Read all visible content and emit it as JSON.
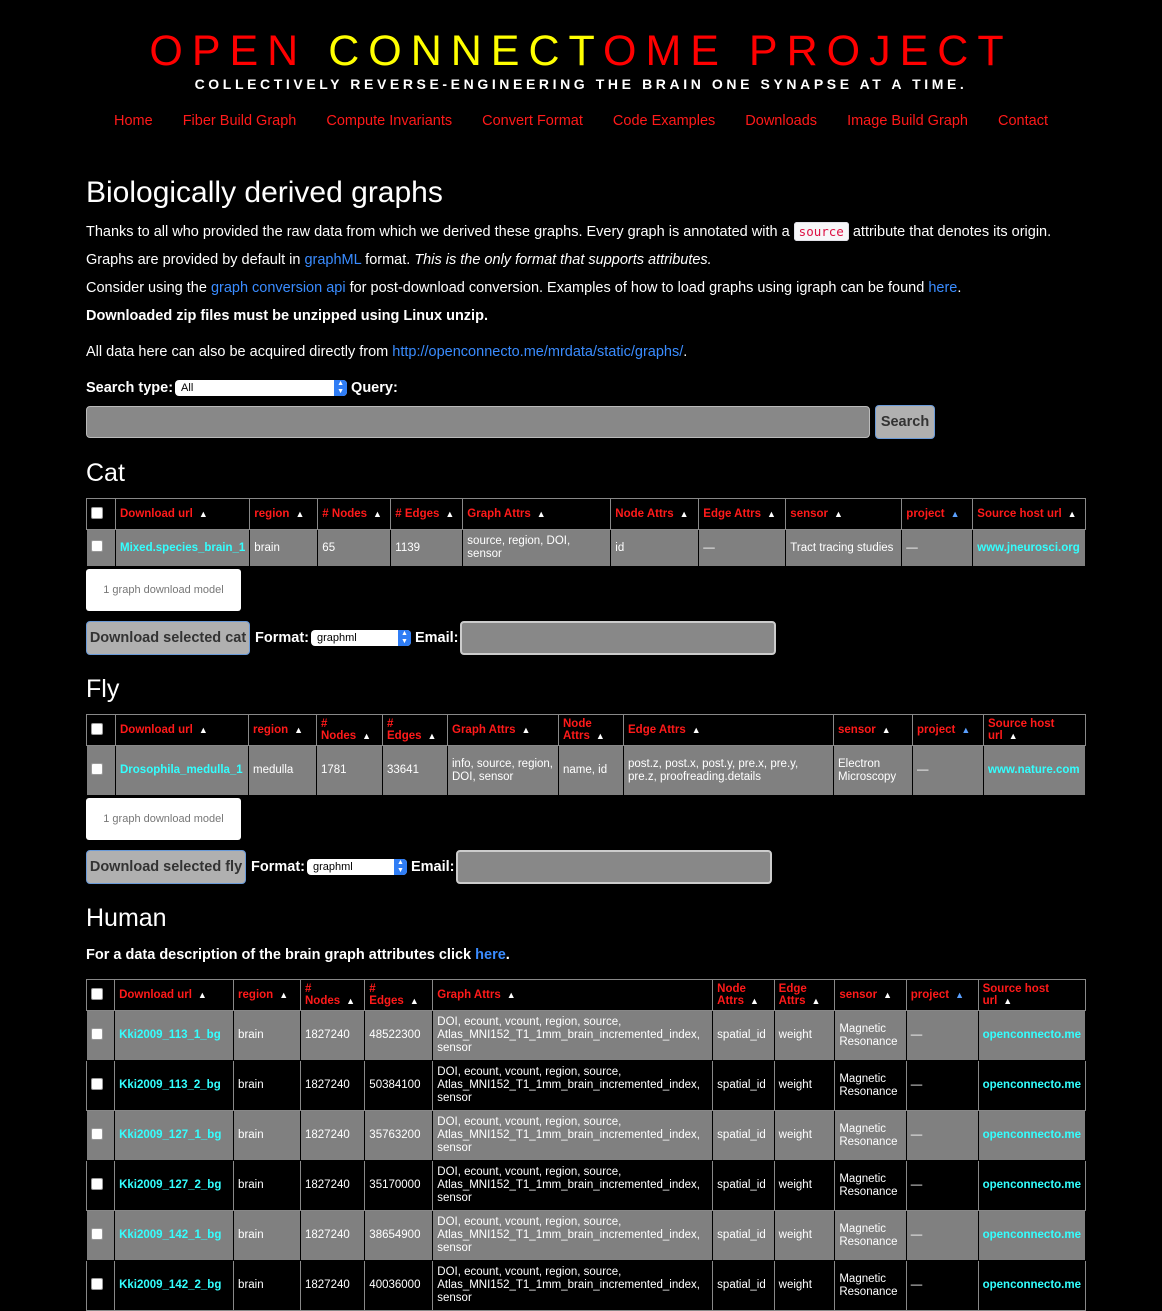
{
  "header": {
    "title_part1": "OPEN ",
    "title_part2": "CONNECT",
    "title_part3": "OME PROJECT",
    "tagline": "COLLECTIVELY REVERSE-ENGINEERING THE BRAIN ONE SYNAPSE AT A TIME."
  },
  "nav": [
    "Home",
    "Fiber Build Graph",
    "Compute Invariants",
    "Convert Format",
    "Code Examples",
    "Downloads",
    "Image Build Graph",
    "Contact"
  ],
  "page": {
    "title": "Biologically derived graphs",
    "p1_before": "Thanks to all who provided the raw data from which we derived these graphs. Every graph is annotated with a ",
    "p1_code": "source",
    "p1_after": " attribute that denotes its origin.",
    "p2_before": "Graphs are provided by default in ",
    "p2_link": "graphML",
    "p2_mid": " format. ",
    "p2_italic": "This is the only format that supports attributes.",
    "p3_before": "Consider using the ",
    "p3_link1": "graph conversion api",
    "p3_mid": " for post-download conversion. Examples of how to load graphs using igraph can be found ",
    "p3_link2": "here",
    "p3_after": ".",
    "p4": "Downloaded zip files must be unzipped using Linux unzip.",
    "p5_before": "All data here can also be acquired directly from ",
    "p5_link": "http://openconnecto.me/mrdata/static/graphs/",
    "p5_after": "."
  },
  "search": {
    "type_label": "Search type:",
    "type_value": "All",
    "query_label": "Query:",
    "button": "Search"
  },
  "cat": {
    "heading": "Cat",
    "headers": [
      "Download url",
      "region",
      "# Nodes",
      "# Edges",
      "Graph Attrs",
      "Node Attrs",
      "Edge Attrs",
      "sensor",
      "project",
      "Source host url"
    ],
    "rows": [
      [
        "Mixed.species_brain_1",
        "brain",
        "65",
        "1139",
        "source, region, DOI, sensor",
        "id",
        "—",
        "Tract tracing studies",
        "—",
        "www.jneurosci.org"
      ]
    ],
    "model_text": "1 graph download model",
    "download_button": "Download selected cat",
    "format_label": "Format:",
    "format_value": "graphml",
    "email_label": "Email:"
  },
  "fly": {
    "heading": "Fly",
    "headers": [
      "Download url",
      "region",
      "# Nodes",
      "# Edges",
      "Graph Attrs",
      "Node Attrs",
      "Edge Attrs",
      "sensor",
      "project",
      "Source host url"
    ],
    "rows": [
      [
        "Drosophila_medulla_1",
        "medulla",
        "1781",
        "33641",
        "info, source, region, DOI, sensor",
        "name, id",
        "post.z, post.x, post.y, pre.x, pre.y, pre.z, proofreading.details",
        "Electron Microscopy",
        "—",
        "www.nature.com"
      ]
    ],
    "model_text": "1 graph download model",
    "download_button": "Download selected fly",
    "format_label": "Format:",
    "format_value": "graphml",
    "email_label": "Email:"
  },
  "human": {
    "heading": "Human",
    "desc_before": "For a data description of the brain graph attributes click ",
    "desc_link": "here",
    "desc_after": ".",
    "headers": [
      "Download url",
      "region",
      "# Nodes",
      "# Edges",
      "Graph Attrs",
      "Node Attrs",
      "Edge Attrs",
      "sensor",
      "project",
      "Source host url"
    ],
    "rows": [
      [
        "Kki2009_113_1_bg",
        "brain",
        "1827240",
        "48522300",
        "DOI, ecount, vcount, region, source, Atlas_MNI152_T1_1mm_brain_incremented_index, sensor",
        "spatial_id",
        "weight",
        "Magnetic Resonance",
        "—",
        "openconnecto.me"
      ],
      [
        "Kki2009_113_2_bg",
        "brain",
        "1827240",
        "50384100",
        "DOI, ecount, vcount, region, source, Atlas_MNI152_T1_1mm_brain_incremented_index, sensor",
        "spatial_id",
        "weight",
        "Magnetic Resonance",
        "—",
        "openconnecto.me"
      ],
      [
        "Kki2009_127_1_bg",
        "brain",
        "1827240",
        "35763200",
        "DOI, ecount, vcount, region, source, Atlas_MNI152_T1_1mm_brain_incremented_index, sensor",
        "spatial_id",
        "weight",
        "Magnetic Resonance",
        "—",
        "openconnecto.me"
      ],
      [
        "Kki2009_127_2_bg",
        "brain",
        "1827240",
        "35170000",
        "DOI, ecount, vcount, region, source, Atlas_MNI152_T1_1mm_brain_incremented_index, sensor",
        "spatial_id",
        "weight",
        "Magnetic Resonance",
        "—",
        "openconnecto.me"
      ],
      [
        "Kki2009_142_1_bg",
        "brain",
        "1827240",
        "38654900",
        "DOI, ecount, vcount, region, source, Atlas_MNI152_T1_1mm_brain_incremented_index, sensor",
        "spatial_id",
        "weight",
        "Magnetic Resonance",
        "—",
        "openconnecto.me"
      ],
      [
        "Kki2009_142_2_bg",
        "brain",
        "1827240",
        "40036000",
        "DOI, ecount, vcount, region, source, Atlas_MNI152_T1_1mm_brain_incremented_index, sensor",
        "spatial_id",
        "weight",
        "Magnetic Resonance",
        "—",
        "openconnecto.me"
      ]
    ]
  },
  "colors": {
    "background": "#000000",
    "title_red": "#ff0000",
    "title_yellow": "#ffff00",
    "link_blue": "#3a8cff",
    "table_link_cyan": "#33ffff",
    "header_red": "#ff1a1a"
  }
}
